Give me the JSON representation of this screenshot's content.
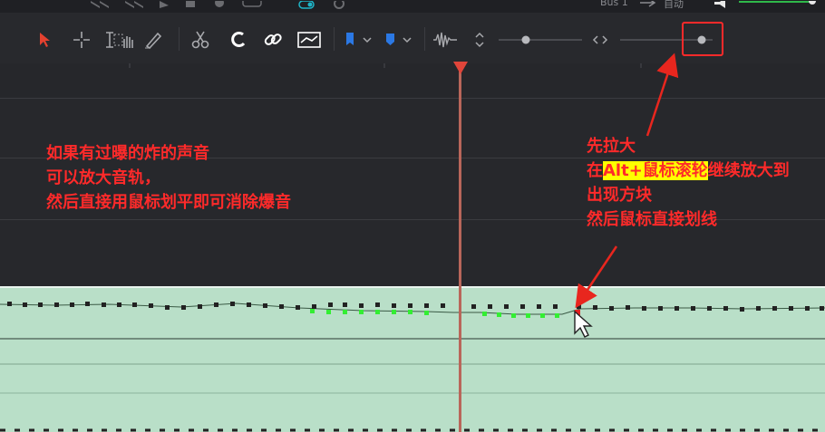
{
  "header": {
    "bus_label": "Bus 1",
    "auto_label": "自动"
  },
  "annotations": {
    "left": [
      "如果有过曝的炸的声音",
      "可以放大音轨，",
      "然后直接用鼠标划平即可消除爆音"
    ],
    "right_line1": "先拉大",
    "right_line2_pre": "在",
    "right_line2_highlight": "Alt+鼠标滚轮",
    "right_line2_post": "继续放大到",
    "right_line3": "出现方块",
    "right_line4": "然后鼠标直接划线"
  },
  "colors": {
    "annotation": "#ff2a2a",
    "highlight": "#ffff00",
    "audio_track": "#b9dfc8",
    "playhead": "#e0453a",
    "flattened_points": "#33ee33"
  }
}
